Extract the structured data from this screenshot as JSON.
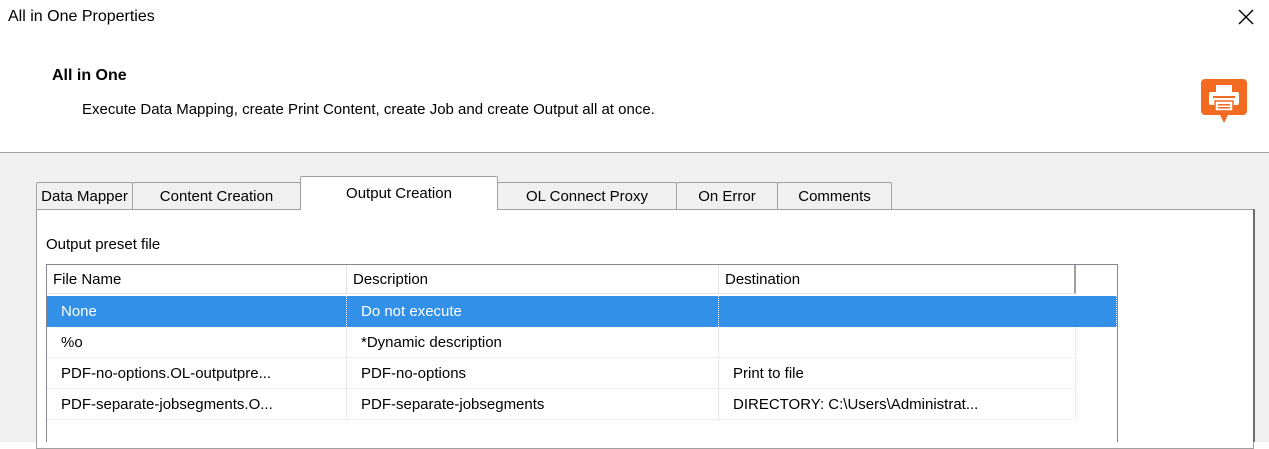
{
  "window": {
    "title": "All in One Properties",
    "close_glyph": "✕"
  },
  "header": {
    "title": "All in One",
    "description": "Execute Data Mapping, create Print Content, create Job and create Output all at once.",
    "icon": "printer-speech-bubble-icon",
    "icon_color": "#f26b21"
  },
  "tabs": [
    {
      "label": "Data Mapper",
      "active": false
    },
    {
      "label": "Content Creation",
      "active": false
    },
    {
      "label": "Output Creation",
      "active": true
    },
    {
      "label": "OL Connect Proxy",
      "active": false
    },
    {
      "label": "On Error",
      "active": false
    },
    {
      "label": "Comments",
      "active": false
    }
  ],
  "output_preset": {
    "group_label": "Output preset file",
    "columns": [
      "File Name",
      "Description",
      "Destination"
    ],
    "rows": [
      {
        "file_name": "None",
        "description": "Do not execute",
        "destination": "",
        "selected": true
      },
      {
        "file_name": "%o",
        "description": "*Dynamic description",
        "destination": "",
        "selected": false
      },
      {
        "file_name": "PDF-no-options.OL-outputpre...",
        "description": "PDF-no-options",
        "destination": "Print to file",
        "selected": false
      },
      {
        "file_name": "PDF-separate-jobsegments.O...",
        "description": "PDF-separate-jobsegments",
        "destination": "DIRECTORY: C:\\Users\\Administrat...",
        "selected": false
      }
    ]
  },
  "colors": {
    "selection": "#3390e8",
    "panel_background": "#f0f0f0"
  }
}
